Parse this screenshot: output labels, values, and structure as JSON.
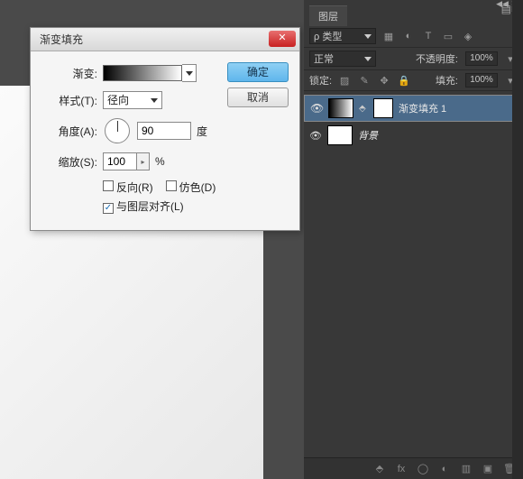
{
  "dialog": {
    "title": "渐变填充",
    "gradient_label": "渐变:",
    "style_label": "样式(T):",
    "style_value": "径向",
    "angle_label": "角度(A):",
    "angle_value": "90",
    "angle_unit": "度",
    "scale_label": "缩放(S):",
    "scale_value": "100",
    "scale_unit": "%",
    "reverse_label": "反向(R)",
    "dither_label": "仿色(D)",
    "align_label": "与图层对齐(L)",
    "ok": "确定",
    "cancel": "取消",
    "close": "✕"
  },
  "layers_panel": {
    "tab": "图层",
    "kind_label": "ρ 类型",
    "blend_mode": "正常",
    "opacity_label": "不透明度:",
    "opacity_value": "100%",
    "lock_label": "锁定:",
    "fill_label": "填充:",
    "fill_value": "100%",
    "items": [
      {
        "name": "渐变填充 1",
        "selected": true,
        "has_mask": true
      },
      {
        "name": "背景",
        "selected": false,
        "has_mask": false
      }
    ],
    "eye": "👁",
    "collapse": "◀◀ ✕",
    "menu": "▤≡"
  }
}
